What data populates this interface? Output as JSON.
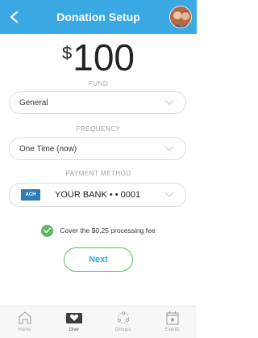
{
  "header": {
    "title": "Donation Setup",
    "back_icon": "chevron-left-icon",
    "bg_color": "#3aa9e3"
  },
  "amount": {
    "currency": "$",
    "value": "100"
  },
  "fund": {
    "label": "FUND",
    "value": "General"
  },
  "frequency": {
    "label": "FREQUENCY",
    "value": "One Time (now)"
  },
  "payment": {
    "label": "PAYMENT METHOD",
    "badge": "ACH",
    "value": "YOUR BANK • • 0001"
  },
  "fee": {
    "text": "Cover the $0.25 processing fee",
    "checked": true
  },
  "next_label": "Next",
  "tabs": [
    {
      "label": "Home",
      "icon": "home-icon",
      "active": false
    },
    {
      "label": "Give",
      "icon": "give-icon",
      "active": true
    },
    {
      "label": "Groups",
      "icon": "groups-icon",
      "active": false
    },
    {
      "label": "Events",
      "icon": "calendar-icon",
      "active": false
    }
  ],
  "colors": {
    "accent": "#3aa9e3",
    "success": "#5cb85c",
    "ach": "#2f7bb8"
  }
}
